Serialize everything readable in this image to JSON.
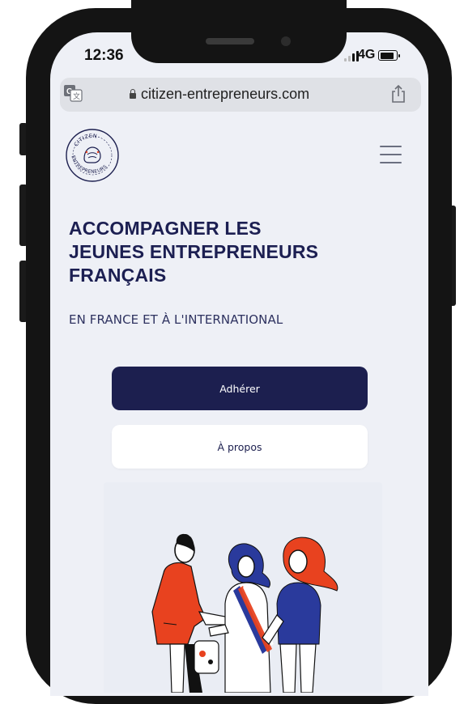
{
  "status_bar": {
    "time": "12:36",
    "network": "4G"
  },
  "browser": {
    "url": "citizen-entrepreneurs.com"
  },
  "logo": {
    "alt": "Citizen Entrepreneurs logo",
    "top_text": "CITIZEN",
    "bottom_text": "ENTREPRENEURS"
  },
  "hero": {
    "title_lines": [
      "ACCOMPAGNER LES",
      "JEUNES ENTREPRENEURS",
      "FRANÇAIS"
    ],
    "subtitle": "EN FRANCE ET À L'INTERNATIONAL"
  },
  "buttons": {
    "join_label": "Adhérer",
    "about_label": "À propos"
  },
  "colors": {
    "navy": "#1c1f4f",
    "red": "#e8421f",
    "blue": "#2a3a9c",
    "page_bg": "#eef0f6"
  },
  "icons": [
    "translate-icon",
    "lock-icon",
    "share-icon",
    "hamburger-menu-icon",
    "battery-icon",
    "signal-icon"
  ]
}
